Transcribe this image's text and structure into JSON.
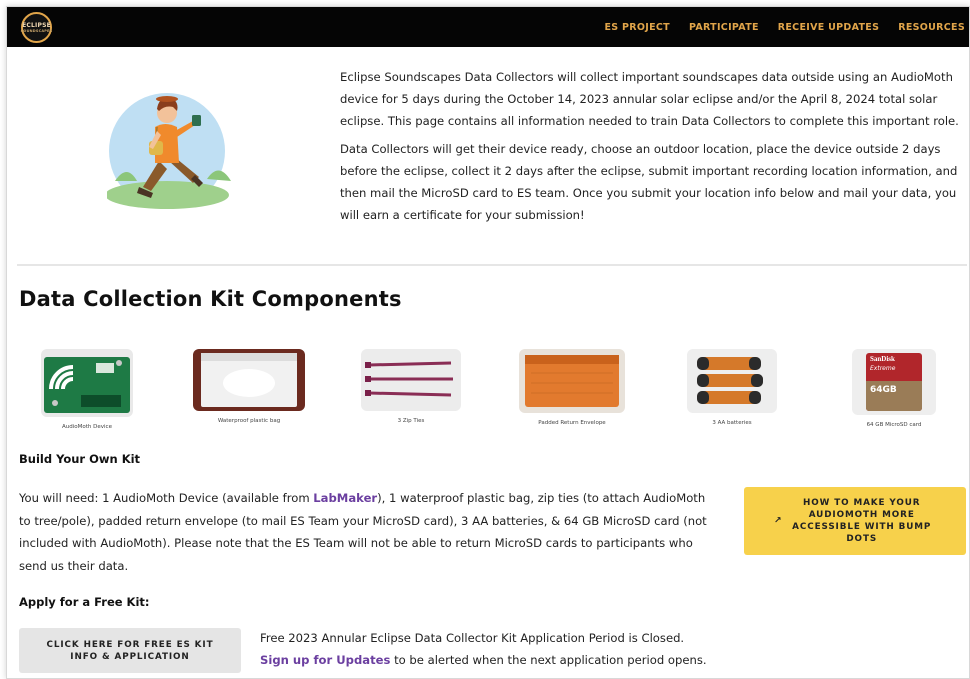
{
  "nav": {
    "logo_text": "ECLIPSE",
    "logo_subtext": "SOUNDSCAPES",
    "links": [
      "ES PROJECT",
      "PARTICIPATE",
      "RECEIVE UPDATES",
      "RESOURCES"
    ]
  },
  "intro": {
    "p1": "Eclipse Soundscapes Data Collectors will collect important soundscapes data outside using an AudioMoth device for 5 days during the October 14, 2023 annular solar eclipse and/or the April 8, 2024 total solar eclipse. This page contains all information needed to train Data Collectors to complete this important role.",
    "p2": "Data Collectors will get their device ready, choose an outdoor location, place the device outside 2 days before the eclipse, collect it 2 days after the eclipse, submit important recording location information, and then mail the MicroSD card to ES team. Once you submit your location info below and mail your data, you will earn a certificate for your submission!"
  },
  "kit": {
    "title": "Data Collection Kit Components",
    "items": [
      {
        "caption": "AudioMoth Device",
        "icon": "audiomoth-device-icon"
      },
      {
        "caption": "Waterproof plastic bag",
        "icon": "plastic-bag-icon"
      },
      {
        "caption": "3 Zip Ties",
        "icon": "zip-ties-icon"
      },
      {
        "caption": "Padded Return Envelope",
        "icon": "envelope-icon"
      },
      {
        "caption": "3 AA batteries",
        "icon": "batteries-icon"
      },
      {
        "caption": "64 GB MicroSD card",
        "icon": "microsd-card-icon"
      }
    ],
    "sd_brand": "SanDisk",
    "sd_line": "Extreme",
    "sd_size": "64GB"
  },
  "build": {
    "heading": "Build Your Own Kit",
    "text_before_link": "You will need: 1 AudioMoth Device (available from ",
    "link_text": "LabMaker",
    "text_after_link": "), 1 waterproof plastic bag, zip ties (to attach AudioMoth to tree/pole), padded return envelope (to mail ES Team your MicroSD card), 3 AA batteries, & 64 GB MicroSD card (not included with AudioMoth). Please note that the ES Team will not be able to return MicroSD cards to participants who send us their data.",
    "accessible_button": "HOW TO MAKE YOUR AUDIOMOTH MORE ACCESSIBLE WITH BUMP DOTS",
    "accessible_icon": "external-link-icon"
  },
  "apply": {
    "heading": "Apply for a Free Kit:",
    "button": "CLICK HERE FOR FREE ES KIT INFO & APPLICATION",
    "closed_text": "Free 2023 Annular Eclipse Data Collector Kit Application Period is Closed.",
    "signup_link": "Sign up for Updates",
    "signup_rest": " to be alerted when the next application period opens."
  },
  "colors": {
    "nav_bg": "#050505",
    "nav_link": "#e1a54a",
    "link": "#6b3fa0",
    "accent_button": "#f7d14b",
    "secondary_button": "#e5e5e5"
  }
}
